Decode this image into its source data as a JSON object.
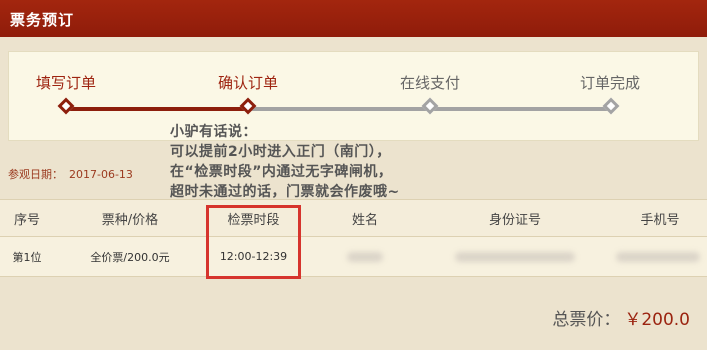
{
  "header": {
    "title": "票务预订"
  },
  "steps": [
    {
      "label": "填写订单",
      "status": "done"
    },
    {
      "label": "确认订单",
      "status": "done"
    },
    {
      "label": "在线支付",
      "status": "todo"
    },
    {
      "label": "订单完成",
      "status": "todo"
    }
  ],
  "note": {
    "lines": [
      "小驴有话说：",
      "可以提前2小时进入正门（南门），",
      "在“检票时段”内通过无字碑闸机，",
      "超时未通过的话，门票就会作废哦~"
    ]
  },
  "visit": {
    "label": "参观日期：",
    "date": "2017-06-13"
  },
  "table": {
    "headers": [
      "序号",
      "票种/价格",
      "检票时段",
      "姓名",
      "身份证号",
      "手机号"
    ],
    "rows": [
      {
        "index": "第1位",
        "ticket": "全价票/200.0元",
        "time_slot": "12:00-12:39"
      }
    ]
  },
  "total": {
    "label": "总票价：",
    "amount": "￥200.0"
  },
  "colors": {
    "header_bg": "#8f1c0a",
    "done_step": "#8d1f0c",
    "todo_step": "#a3a3a3",
    "highlight": "#d6342d"
  }
}
